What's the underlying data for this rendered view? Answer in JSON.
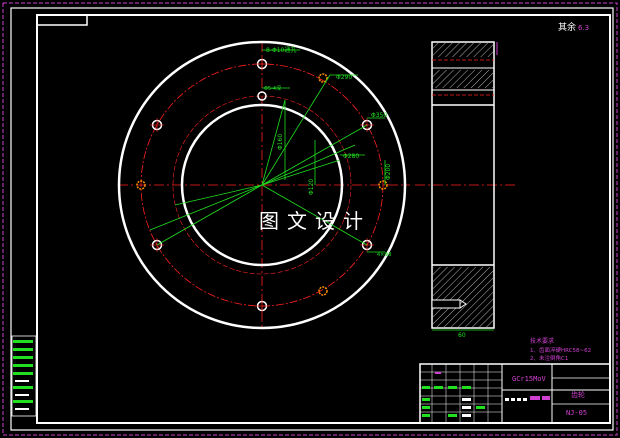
{
  "drawing": {
    "surface_note": "其余",
    "surface_value": "6.3",
    "watermark": "图文设计",
    "dimensions": {
      "pcd_top": "8-Φ10通孔",
      "hole_label_2": "Φ5-4深",
      "dia_a": "Φ290",
      "dia_b": "Φ350",
      "dia_c": "Φ280",
      "dia_d": "Φ160",
      "dia_e": "Φ120",
      "dia_f": "Φ200",
      "dia_g": "Φ130",
      "small_r": "4×Φ8",
      "side_width": "60"
    },
    "notes": {
      "title": "技术要求",
      "line1": "1、齿面淬硬HRC58~62",
      "line2": "2、未注倒角C1"
    },
    "title_block": {
      "material": "GCr15MoV",
      "part_name": "齿轮",
      "drawing_no": "NJ-05"
    }
  }
}
